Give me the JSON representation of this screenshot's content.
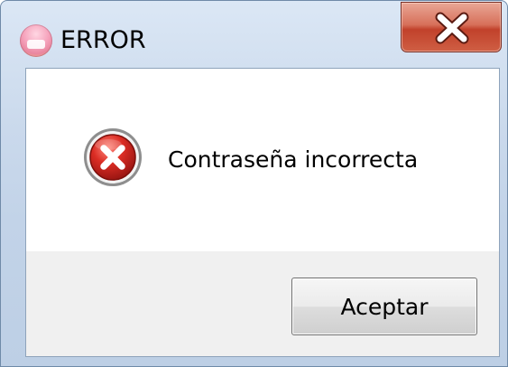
{
  "window": {
    "title": "ERROR",
    "app_icon": "app-icon",
    "close_icon": "close-icon"
  },
  "dialog": {
    "icon": "error-icon",
    "message": "Contraseña incorrecta",
    "ok_label": "Aceptar"
  },
  "colors": {
    "close_button": "#c7472f",
    "error_icon": "#c7221b",
    "content_background": "#ffffff",
    "button_area_background": "#f0f0f0"
  }
}
